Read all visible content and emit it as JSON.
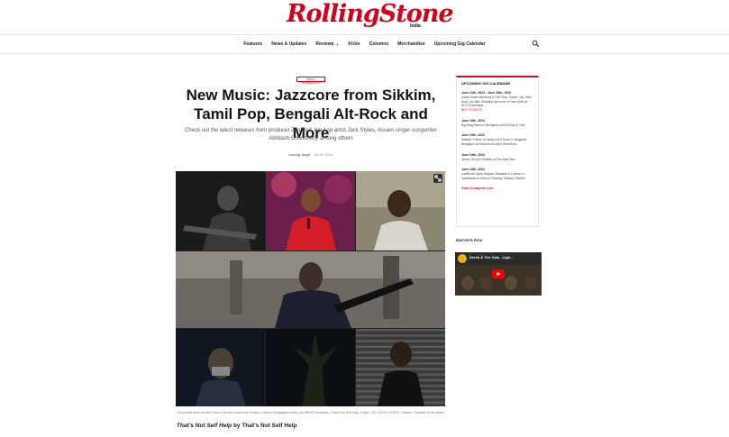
{
  "brand": {
    "name": "RollingStone",
    "edition": "India",
    "accent": "#d0021b"
  },
  "nav": {
    "items": [
      {
        "label": "Features",
        "dropdown": false
      },
      {
        "label": "News & Updates",
        "dropdown": false
      },
      {
        "label": "Reviews",
        "dropdown": true
      },
      {
        "label": "Kicks",
        "dropdown": false
      },
      {
        "label": "Columns",
        "dropdown": false
      },
      {
        "label": "Merchandise",
        "dropdown": false
      },
      {
        "label": "Upcoming Gig Calendar",
        "dropdown": false
      }
    ],
    "search_icon": "search-icon"
  },
  "article": {
    "tag": "NEW & NOTEWORTHY",
    "title": "New Music: Jazzcore from Sikkim, Tamil Pop, Bengali Alt-Rock and More",
    "excerpt": "Check out the latest releases from producer Zen Diaf, hip-hop artist Jack Styles, Assam singer-songwriter Abhilash Choudhury, among others",
    "author": "Anurag Tagat",
    "date": "Jul 02, 2021",
    "caption": "(Clockwise from top left) Tune in to new music from Sukkin, Lothrin (Vinayagamoorthy) and Nikhil Fernandes, Thank Not Self Help, Nukul, 1311 DOCE x DEHO, Shakes. Courtesy of the artists",
    "subhead_italic": "That's Not Self Help",
    "subhead_rest": " by That's Not Self Help"
  },
  "sidebar": {
    "calendar_title": "UPCOMING GIG CALENDAR",
    "events": [
      {
        "date": "June 22th, 2022 - June 26th, 2022",
        "desc": "Queer Made Weekend ft The Fikss, Kavan, Jay Jhelli Bodi\" Qui Bell, Siddhant and more in New Delhi at DLF Promenade",
        "link": "BUY TICKETS"
      },
      {
        "date": "June 24th, 2022",
        "desc": "Big Bang Blues in Bengaluru at RCB Bar & Cafe",
        "link": ""
      },
      {
        "date": "June 24th, 2022",
        "desc": "Saladin: Tribute to System of a Down ft. Bulgarisk Bengaluru at Fandom At Gilly's Redefined",
        "link": ""
      },
      {
        "date": "June 24th, 2022",
        "desc": "Jimmy Thing in Kolkata at Five Mad Men",
        "link": ""
      },
      {
        "date": "June 24th, 2022",
        "desc": "LiveBooth: Arjun Nagara, Mosaede & Loeben in Hyderabad at Jeeroo2 Brewing 'Infusion' Starfire",
        "link": ""
      }
    ],
    "view_more": "View Complete List",
    "editors_pick_title": "EDITOR'S PICK",
    "video_title": "Derek & The Cats - Ligh..."
  }
}
